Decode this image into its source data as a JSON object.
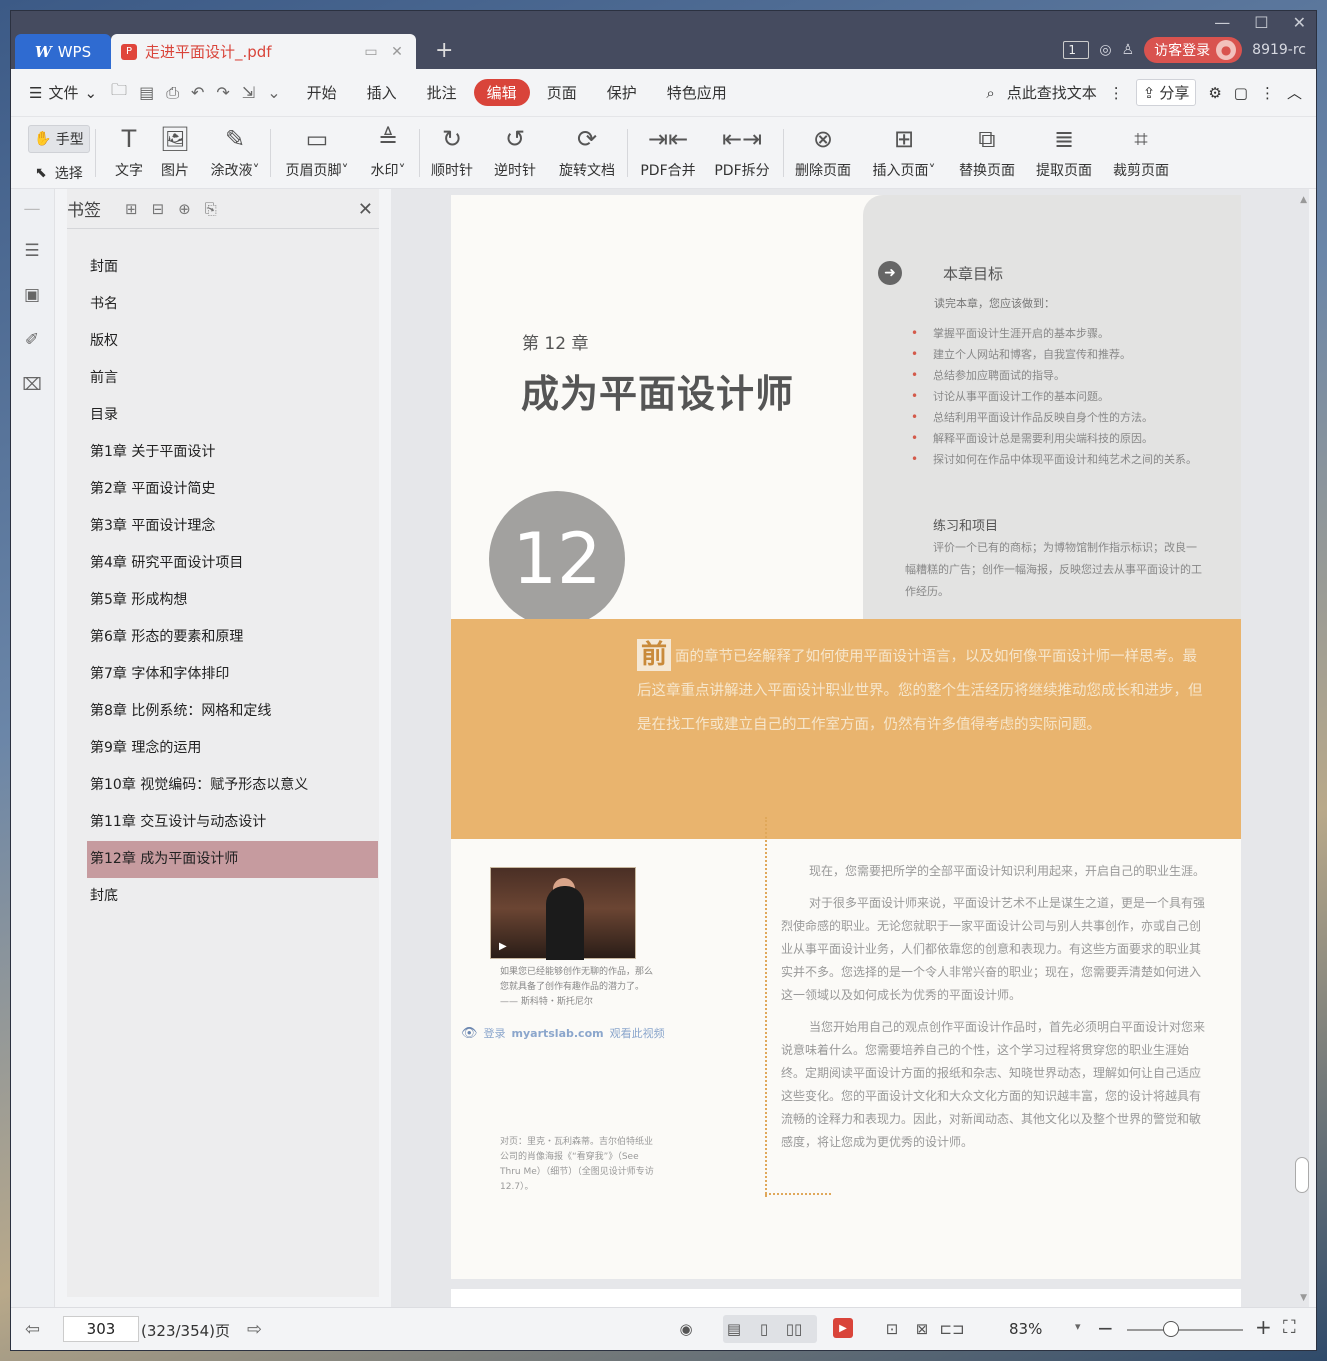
{
  "titlebar": {
    "app_label": "WPS",
    "doc_tab_title": "走进平面设计_.pdf",
    "page_badge": "1",
    "guest_login": "访客登录",
    "version": "8919-rc"
  },
  "menubar": {
    "file": "文件",
    "tabs": [
      "开始",
      "插入",
      "批注",
      "编辑",
      "页面",
      "保护",
      "特色应用"
    ],
    "active_tab": "编辑",
    "search_placeholder": "点此查找文本",
    "share": "分享"
  },
  "toolbar": {
    "hand": "手型",
    "select": "选择",
    "tools": [
      "文字",
      "图片",
      "涂改液",
      "页眉页脚",
      "水印",
      "顺时针",
      "逆时针",
      "旋转文档",
      "PDF合并",
      "PDF拆分",
      "删除页面",
      "插入页面",
      "替换页面",
      "提取页面",
      "裁剪页面"
    ]
  },
  "bookmarks": {
    "title": "书签",
    "items": [
      "封面",
      "书名",
      "版权",
      "前言",
      "目录",
      "第1章  关于平面设计",
      "第2章  平面设计简史",
      "第3章  平面设计理念",
      "第4章  研究平面设计项目",
      "第5章  形成构想",
      "第6章  形态的要素和原理",
      "第7章  字体和字体排印",
      "第8章  比例系统：网格和定线",
      "第9章  理念的运用",
      "第10章  视觉编码：赋予形态以意义",
      "第11章  交互设计与动态设计",
      "第12章  成为平面设计师",
      "封底"
    ],
    "selected_index": 16
  },
  "page": {
    "chapter_label": "第 12 章",
    "chapter_title": "成为平面设计师",
    "chapter_number": "12",
    "goals_title": "本章目标",
    "goals_intro": "读完本章，您应该做到：",
    "goals": [
      "掌握平面设计生涯开启的基本步骤。",
      "建立个人网站和博客，自我宣传和推荐。",
      "总结参加应聘面试的指导。",
      "讨论从事平面设计工作的基本问题。",
      "总结利用平面设计作品反映自身个性的方法。",
      "解释平面设计总是需要利用尖端科技的原因。",
      "探讨如何在作品中体现平面设计和纯艺术之间的关系。"
    ],
    "practice_title": "练习和项目",
    "practice_text": "评价一个已有的商标；为博物馆制作指示标识；改良一幅糟糕的广告；创作一幅海报，反映您过去从事平面设计的工作经历。",
    "intro_dropcap": "前",
    "intro_text": "面的章节已经解释了如何使用平面设计语言，以及如何像平面设计师一样思考。最后这章重点讲解进入平面设计职业世界。您的整个生活经历将继续推动您成长和进步，但是在找工作或建立自己的工作室方面，仍然有许多值得考虑的实际问题。",
    "photo_caption": "如果您已经能够创作无聊的作品，那么您就具备了创作有趣作品的潜力了。—— 斯科特・斯托尼尔",
    "watch_login": "登录",
    "watch_site": "myartslab.com",
    "watch_action": "观看此视频",
    "opposite_caption": "对页：里克・瓦利森蒂。吉尔伯特纸业公司的肖像海报《“看穿我”》（See Thru Me）（细节）（全图见设计师专访 12.7）。",
    "body": [
      "现在，您需要把所学的全部平面设计知识利用起来，开启自己的职业生涯。",
      "对于很多平面设计师来说，平面设计艺术不止是谋生之道，更是一个具有强烈使命感的职业。无论您就职于一家平面设计公司与别人共事创作，亦或自己创业从事平面设计业务，人们都依靠您的创意和表现力。有这些方面要求的职业其实并不多。您选择的是一个令人非常兴奋的职业；现在，您需要弄清楚如何进入这一领域以及如何成长为优秀的平面设计师。",
      "当您开始用自己的观点创作平面设计作品时，首先必须明白平面设计对您来说意味着什么。您需要培养自己的个性，这个学习过程将贯穿您的职业生涯始终。定期阅读平面设计方面的报纸和杂志、知晓世界动态，理解如何让自己适应这些变化。您的平面设计文化和大众文化方面的知识越丰富，您的设计将越具有流畅的诠释力和表现力。因此，对新闻动态、其他文化以及整个世界的警觉和敏感度，将让您成为更优秀的设计师。"
    ]
  },
  "statusbar": {
    "page_input": "303",
    "page_total": "(323/354)页",
    "zoom": "83%"
  },
  "colors": {
    "accent": "#d9443a",
    "titlebar": "#454b5f",
    "selected_bookmark": "#c69b9f",
    "orange_band": "#e9b46e"
  }
}
